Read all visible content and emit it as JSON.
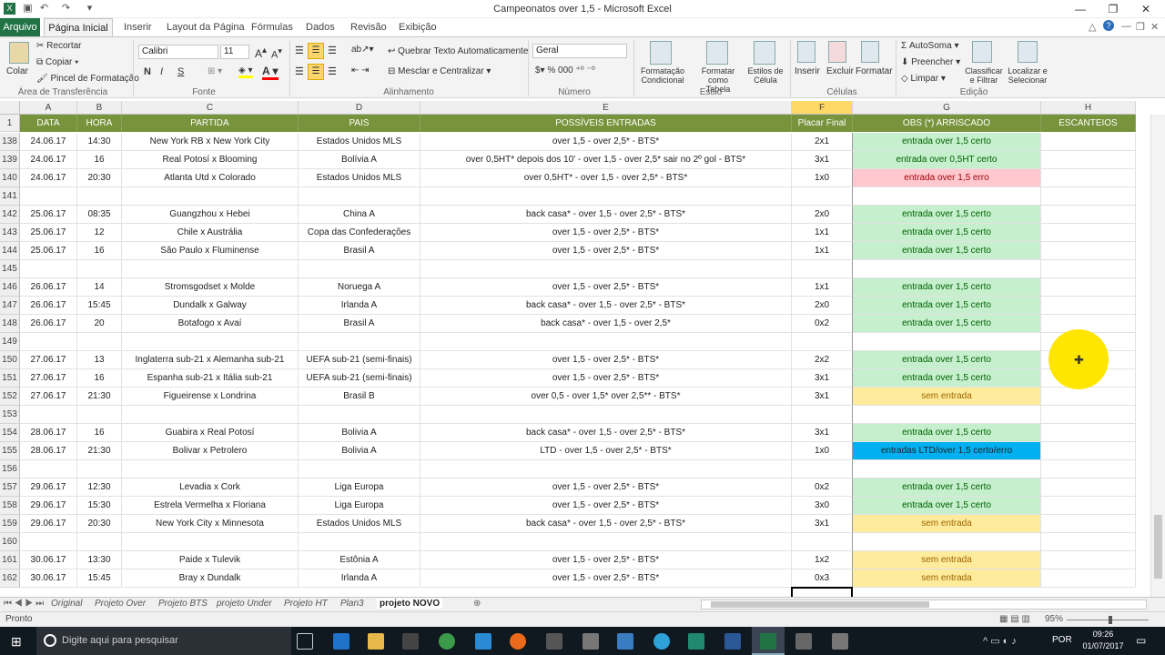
{
  "window": {
    "title": "Campeonatos over 1,5  -  Microsoft Excel",
    "controls": {
      "minimize": "—",
      "restore": "❐",
      "close": "✕"
    }
  },
  "ribbon_tabs": [
    "Página Inicial",
    "Inserir",
    "Layout da Página",
    "Fórmulas",
    "Dados",
    "Revisão",
    "Exibição"
  ],
  "file_tab": "Arquivo",
  "ribbon": {
    "clipboard": {
      "paste": "Colar",
      "cut": "Recortar",
      "copy": "Copiar",
      "format_painter": "Pincel de Formatação",
      "group": "Área de Transferência"
    },
    "font": {
      "name": "Calibri",
      "size": "11",
      "group": "Fonte",
      "bold": "N",
      "italic": "I",
      "underline": "S"
    },
    "alignment": {
      "wrap": "Quebrar Texto Automaticamente",
      "merge": "Mesclar e Centralizar",
      "group": "Alinhamento"
    },
    "number": {
      "format": "Geral",
      "group": "Número"
    },
    "styles": {
      "cond": "Formatação Condicional",
      "table": "Formatar como Tabela",
      "cell": "Estilos de Célula",
      "group": "Estilo"
    },
    "cells": {
      "insert": "Inserir",
      "delete": "Excluir",
      "format": "Formatar",
      "group": "Células"
    },
    "editing": {
      "autosum": "AutoSoma",
      "fill": "Preencher",
      "clear": "Limpar",
      "sort": "Classificar e Filtrar",
      "find": "Localizar e Selecionar",
      "group": "Edição"
    }
  },
  "columns": [
    "A",
    "B",
    "C",
    "D",
    "E",
    "F",
    "G",
    "H"
  ],
  "header_row": {
    "num": "1",
    "cells": [
      "DATA",
      "HORA",
      "PARTIDA",
      "PAIS",
      "POSSÍVEIS ENTRADAS",
      "Placar Final",
      "OBS (*) ARRISCADO",
      "ESCANTEIOS"
    ]
  },
  "rows": [
    {
      "num": "138",
      "cells": [
        "24.06.17",
        "14:30",
        "New York RB x New York City",
        "Estados Unidos MLS",
        "over 1,5 - over 2,5* - BTS*",
        "2x1",
        "entrada over 1,5 certo",
        ""
      ],
      "status": "green"
    },
    {
      "num": "139",
      "cells": [
        "24.06.17",
        "16",
        "Real Potosí x Blooming",
        "Bolívia A",
        "over 0,5HT* depois dos 10' - over 1,5 - over 2,5* sair no 2º gol - BTS*",
        "3x1",
        "entrada over 0,5HT certo",
        ""
      ],
      "status": "green"
    },
    {
      "num": "140",
      "cells": [
        "24.06.17",
        "20:30",
        "Atlanta Utd x Colorado",
        "Estados Unidos MLS",
        "over 0,5HT* - over 1,5 - over 2,5* - BTS*",
        "1x0",
        "entrada over 1,5 erro",
        ""
      ],
      "status": "red"
    },
    {
      "num": "141",
      "cells": [
        "",
        "",
        "",
        "",
        "",
        "",
        "",
        ""
      ],
      "status": "none"
    },
    {
      "num": "142",
      "cells": [
        "25.06.17",
        "08:35",
        "Guangzhou x Hebei",
        "China A",
        "back casa* - over 1,5 - over 2,5* - BTS*",
        "2x0",
        "entrada over 1,5 certo",
        ""
      ],
      "status": "green"
    },
    {
      "num": "143",
      "cells": [
        "25.06.17",
        "12",
        "Chile x Austrália",
        "Copa das Confederações",
        "over 1,5 - over 2,5* - BTS*",
        "1x1",
        "entrada over 1,5 certo",
        ""
      ],
      "status": "green"
    },
    {
      "num": "144",
      "cells": [
        "25.06.17",
        "16",
        "São Paulo x Fluminense",
        "Brasil A",
        "over 1,5 - over 2,5* - BTS*",
        "1x1",
        "entrada over 1,5 certo",
        ""
      ],
      "status": "green"
    },
    {
      "num": "145",
      "cells": [
        "",
        "",
        "",
        "",
        "",
        "",
        "",
        ""
      ],
      "status": "none"
    },
    {
      "num": "146",
      "cells": [
        "26.06.17",
        "14",
        "Stromsgodset x Molde",
        "Noruega A",
        "over 1,5 - over 2,5* - BTS*",
        "1x1",
        "entrada over 1,5 certo",
        ""
      ],
      "status": "green"
    },
    {
      "num": "147",
      "cells": [
        "26.06.17",
        "15:45",
        "Dundalk x Galway",
        "Irlanda A",
        "back casa* - over 1,5 - over 2,5* - BTS*",
        "2x0",
        "entrada over 1,5 certo",
        ""
      ],
      "status": "green"
    },
    {
      "num": "148",
      "cells": [
        "26.06.17",
        "20",
        "Botafogo x Avaí",
        "Brasil A",
        "back casa* - over 1,5 - over 2,5*",
        "0x2",
        "entrada over 1,5 certo",
        ""
      ],
      "status": "green"
    },
    {
      "num": "149",
      "cells": [
        "",
        "",
        "",
        "",
        "",
        "",
        "",
        ""
      ],
      "status": "none"
    },
    {
      "num": "150",
      "cells": [
        "27.06.17",
        "13",
        "Inglaterra sub-21 x Alemanha sub-21",
        "UEFA sub-21 (semi-finais)",
        "over 1,5 - over 2,5* - BTS*",
        "2x2",
        "entrada over 1,5 certo",
        ""
      ],
      "status": "green"
    },
    {
      "num": "151",
      "cells": [
        "27.06.17",
        "16",
        "Espanha sub-21 x Itália sub-21",
        "UEFA sub-21 (semi-finais)",
        "over 1,5 - over 2,5* - BTS*",
        "3x1",
        "entrada over 1,5 certo",
        ""
      ],
      "status": "green"
    },
    {
      "num": "152",
      "cells": [
        "27.06.17",
        "21:30",
        "Figueirense x Londrina",
        "Brasil B",
        "over 0,5 - over 1,5* over 2,5** - BTS*",
        "3x1",
        "sem entrada",
        ""
      ],
      "status": "yellow"
    },
    {
      "num": "153",
      "cells": [
        "",
        "",
        "",
        "",
        "",
        "",
        "",
        ""
      ],
      "status": "none"
    },
    {
      "num": "154",
      "cells": [
        "28.06.17",
        "16",
        "Guabira x Real Potosí",
        "Bolivia A",
        "back casa* - over 1,5 - over 2,5* - BTS*",
        "3x1",
        "entrada over 1,5 certo",
        ""
      ],
      "status": "green"
    },
    {
      "num": "155",
      "cells": [
        "28.06.17",
        "21:30",
        "Bolivar x Petrolero",
        "Bolivia A",
        "LTD - over 1,5 - over 2,5* - BTS*",
        "1x0",
        "entradas LTD/over 1,5 certo/erro",
        ""
      ],
      "status": "blue"
    },
    {
      "num": "156",
      "cells": [
        "",
        "",
        "",
        "",
        "",
        "",
        "",
        ""
      ],
      "status": "none"
    },
    {
      "num": "157",
      "cells": [
        "29.06.17",
        "12:30",
        "Levadia x Cork",
        "Liga Europa",
        "over 1,5 - over 2,5* - BTS*",
        "0x2",
        "entrada over 1,5 certo",
        ""
      ],
      "status": "green"
    },
    {
      "num": "158",
      "cells": [
        "29.06.17",
        "15:30",
        "Estrela Vermelha x Floriana",
        "Liga Europa",
        "over 1,5 - over 2,5* - BTS*",
        "3x0",
        "entrada over 1,5 certo",
        ""
      ],
      "status": "green"
    },
    {
      "num": "159",
      "cells": [
        "29.06.17",
        "20:30",
        "New York City x Minnesota",
        "Estados Unidos MLS",
        "back casa* - over 1,5 - over 2,5* - BTS*",
        "3x1",
        "sem entrada",
        ""
      ],
      "status": "yellow"
    },
    {
      "num": "160",
      "cells": [
        "",
        "",
        "",
        "",
        "",
        "",
        "",
        ""
      ],
      "status": "none"
    },
    {
      "num": "161",
      "cells": [
        "30.06.17",
        "13:30",
        "Paide x Tulevik",
        "Estônia A",
        "over 1,5 - over 2,5* - BTS*",
        "1x2",
        "sem entrada",
        ""
      ],
      "status": "yellow"
    },
    {
      "num": "162",
      "cells": [
        "30.06.17",
        "15:45",
        "Bray x Dundalk",
        "Irlanda A",
        "over 1,5 - over 2,5* - BTS*",
        "0x3",
        "sem entrada",
        ""
      ],
      "status": "yellow"
    }
  ],
  "colors": {
    "header": "#77933c",
    "green": "#c6efce",
    "green_text": "#006100",
    "red": "#ffc7ce",
    "red_text": "#9c0006",
    "yellow": "#ffeb9c",
    "yellow_text": "#9c6500",
    "blue": "#00b0f0",
    "blue_text": "#1f1f1f",
    "selected_col": "#ffd966"
  },
  "sheets": [
    "Original",
    "Projeto Over",
    "Projeto BTS",
    "projeto Under",
    "Projeto HT",
    "Plan3",
    "projeto NOVO"
  ],
  "active_sheet": "projeto NOVO",
  "status": {
    "ready": "Pronto",
    "zoom": "95%"
  },
  "taskbar": {
    "search": "Digite aqui para pesquisar",
    "lang": "POR",
    "time": "09:26",
    "date": "01/07/2017"
  }
}
